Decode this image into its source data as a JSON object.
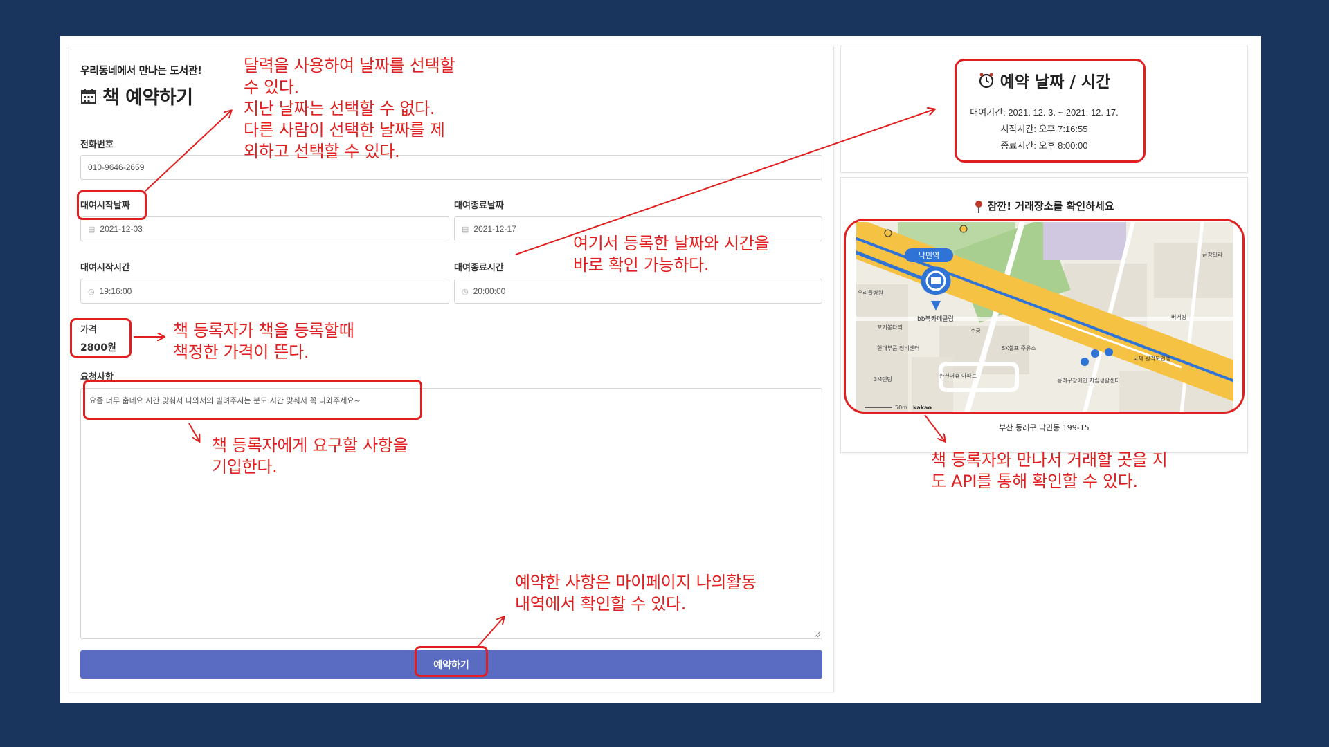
{
  "form": {
    "subtitle": "우리동네에서 만나는 도서관!",
    "title": "책 예약하기",
    "title_icon": "calendar-icon",
    "phone_label": "전화번호",
    "phone_value": "010-9646-2659",
    "start_date_label": "대여시작날짜",
    "start_date_value": "2021-12-03",
    "end_date_label": "대여종료날짜",
    "end_date_value": "2021-12-17",
    "start_time_label": "대여시작시간",
    "start_time_value": "19:16:00",
    "end_time_label": "대여종료시간",
    "end_time_value": "20:00:00",
    "price_label": "가격",
    "price_value": "2800원",
    "request_label": "요청사항",
    "request_value": "요즘 너무 춥네요 시간 맞춰서 나와서의 빌려주시는 분도 시간 맞춰서 꼭 나와주세요~",
    "submit_label": "예약하기",
    "submit_color": "#5a6bc2"
  },
  "reservation_info": {
    "icon": "clock-icon",
    "title": "예약 날짜 / 시간",
    "period": "대여기간: 2021. 12. 3. ~ 2021. 12. 17.",
    "start_time": "시작시간: 오후 7:16:55",
    "end_time": "종료시간: 오후 8:00:00"
  },
  "map_panel": {
    "icon": "pin-icon",
    "title": "잠깐! 거래장소를 확인하세요",
    "caption": "부산 동래구 낙민동 199-15",
    "labels": {
      "station": "낙민역",
      "place": "bb북카페클럽",
      "scale": "50m",
      "brand": "kakao",
      "hospital": "우리들병원",
      "repair": "현대부품 정비센터",
      "gas": "SK셀프 주유소",
      "apt": "한신더휴 아파트",
      "center": "동래구장애인 자립생활센터",
      "bank": "국제 원격도면행",
      "burger": "버거킹",
      "villa": "금강빌라",
      "cafe": "수궁",
      "ktm": "3M렌팅",
      "meat": "꼬기봉다리"
    }
  },
  "annotations": {
    "accent_color": "#e02020",
    "calendar_note": "달력을 사용하여 날짜를 선택할\n수 있다.\n지난 날짜는 선택할 수 없다.\n다른 사람이 선택한 날짜를 제\n외하고 선택할 수 있다.",
    "price_note": "책 등록자가 책을 등록할때\n책정한 가격이 뜬다.",
    "request_note": "책 등록자에게 요구할 사항을\n기입한다.",
    "confirm_note": "여기서 등록한 날짜와 시간을\n바로 확인 가능하다.",
    "mypage_note": "예약한 사항은 마이페이지 나의활동\n내역에서 확인할 수 있다.",
    "map_note": "책 등록자와 만나서 거래할 곳을 지\n도 API를 통해 확인할 수 있다."
  }
}
